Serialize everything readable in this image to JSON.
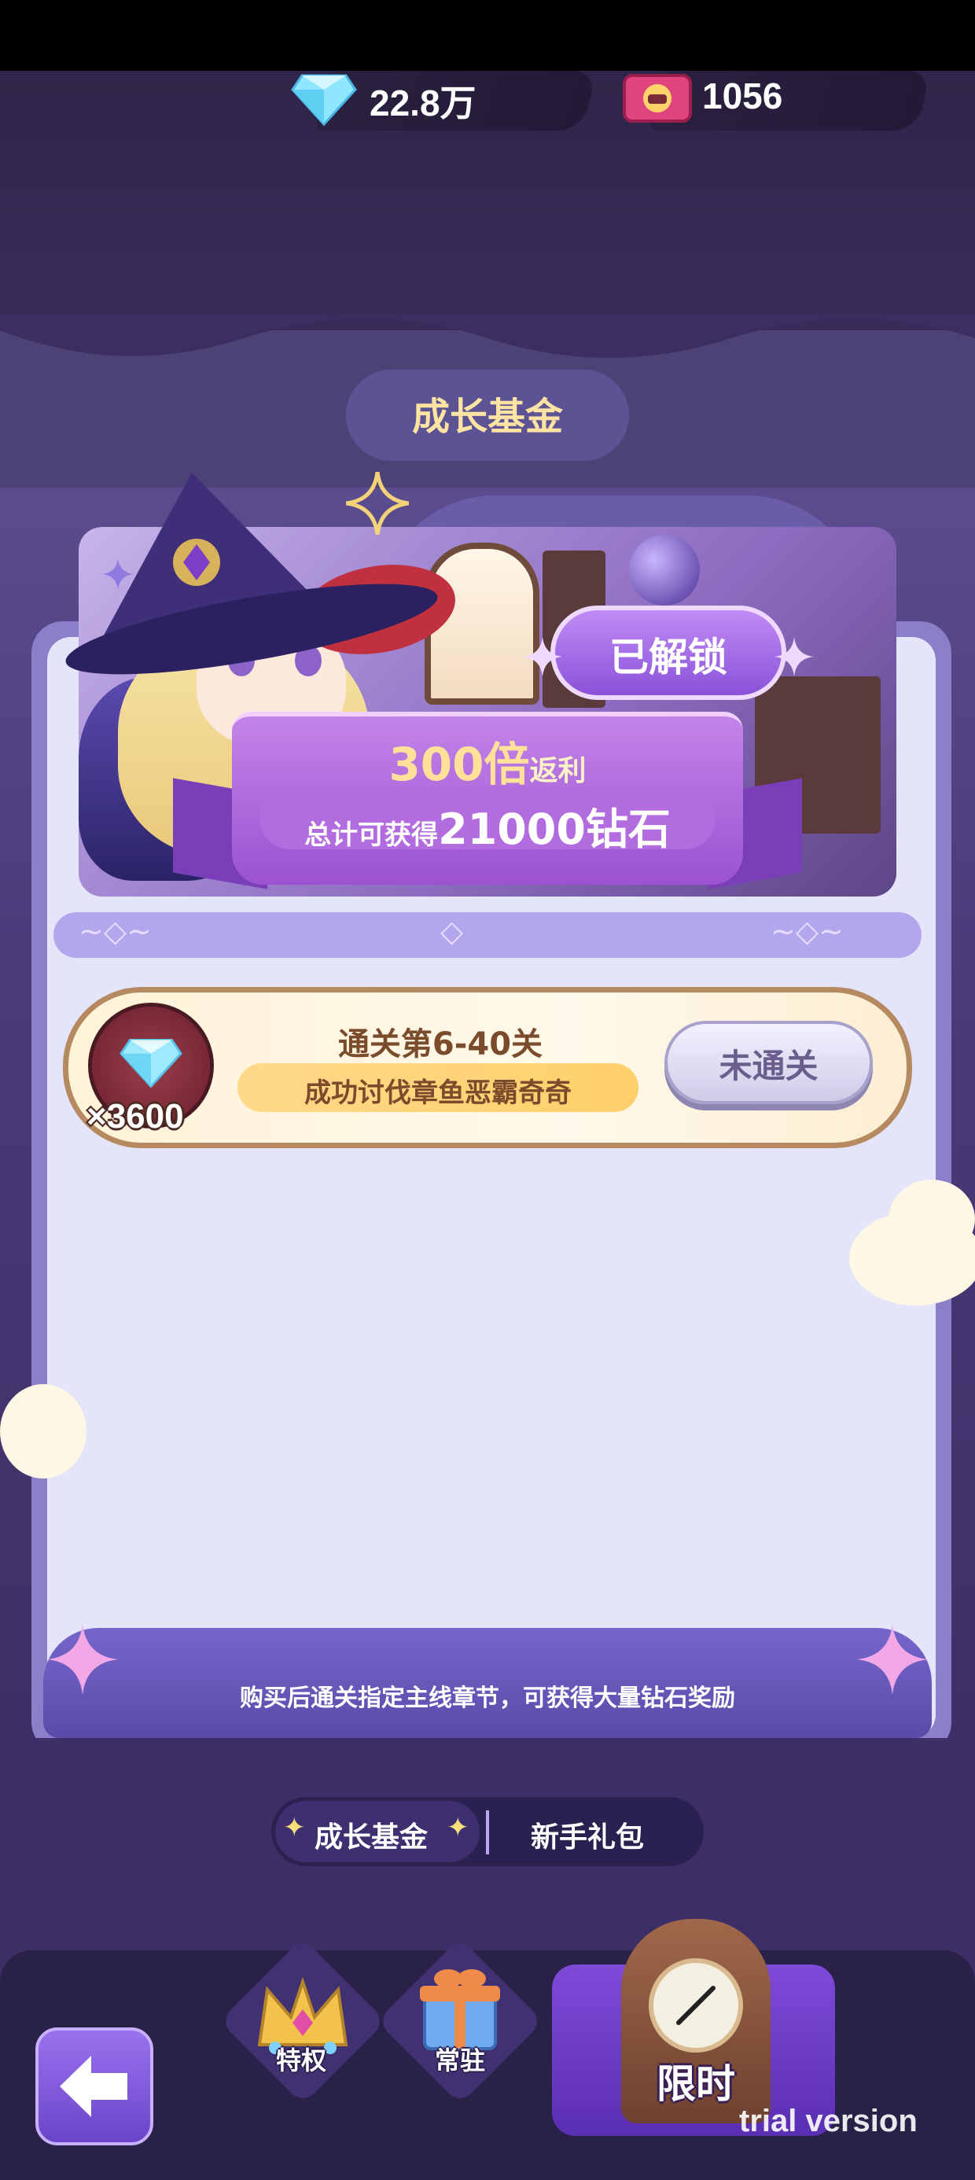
{
  "currency": {
    "diamonds": "22.8万",
    "tickets": "1056"
  },
  "page": {
    "title": "成长基金"
  },
  "fund_banner": {
    "unlocked_label": "已解锁",
    "rebate_multiplier": "300倍",
    "rebate_word": "返利",
    "total_prefix": "总计可获得",
    "total_amount": "21000钻石"
  },
  "reward_row": {
    "quantity": "×3600",
    "stage_title": "通关第6-40关",
    "stage_desc": "成功讨伐章鱼恶霸奇奇",
    "status_button": "未通关"
  },
  "footer_note": "购买后通关指定主线章节，可获得大量钻石奖励",
  "tabs": [
    {
      "label": "成长基金",
      "active": true
    },
    {
      "label": "新手礼包",
      "active": false
    }
  ],
  "bottom_nav": {
    "privilege": "特权",
    "permanent": "常驻",
    "limited": "限时"
  },
  "watermark": "trial version",
  "colors": {
    "accent_purple": "#8a52d9",
    "gold_text": "#ffe19a"
  }
}
